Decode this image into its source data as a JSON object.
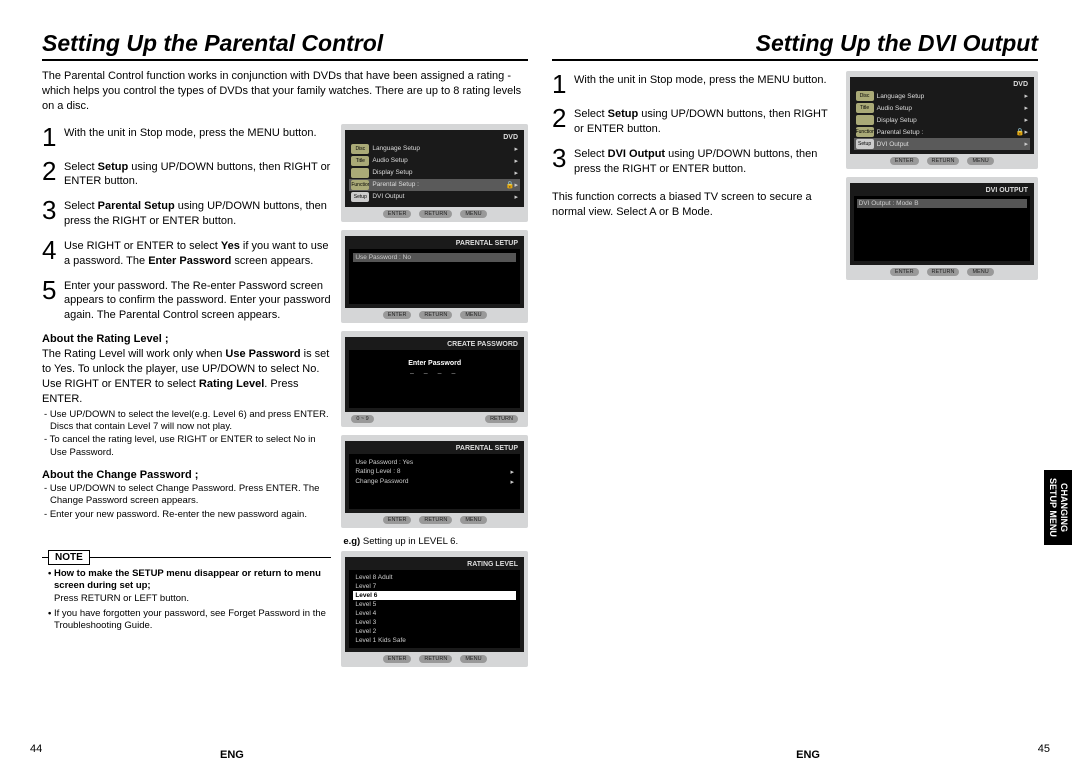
{
  "left": {
    "title": "Setting Up the Parental Control",
    "intro": "The Parental Control function works in conjunction with DVDs that have been assigned a rating - which helps you control the types of DVDs that your family watches. There are up to 8 rating levels on a disc.",
    "steps": {
      "s1": "With the unit in Stop mode, press the MENU button.",
      "s2a": "Select ",
      "s2b": "Setup",
      "s2c": " using UP/DOWN buttons, then RIGHT or ENTER button.",
      "s3a": "Select ",
      "s3b": "Parental Setup",
      "s3c": " using UP/DOWN buttons, then press the RIGHT or ENTER button.",
      "s4a": "Use RIGHT or ENTER to select ",
      "s4b": "Yes",
      "s4c": " if you want to use a password. The ",
      "s4d": "Enter Password",
      "s4e": " screen appears.",
      "s5": "Enter your password. The Re-enter Password screen appears to confirm the password. Enter your password again. The Parental Control screen appears."
    },
    "ratingHeading": "About the Rating Level ;",
    "ratingBodyA": "The Rating Level will work only when ",
    "ratingBodyB": "Use Password",
    "ratingBodyC": " is set to Yes. To unlock the player, use UP/DOWN to select No. Use RIGHT or ENTER to select ",
    "ratingBodyD": "Rating Level",
    "ratingBodyE": ". Press ENTER.",
    "ratingBullets": [
      "Use UP/DOWN to select the level(e.g. Level 6) and press ENTER. Discs that contain Level 7 will now not play.",
      "To cancel the rating level, use RIGHT or ENTER to select No in Use Password."
    ],
    "pwHeading": "About the Change Password ;",
    "pwBullets": [
      "Use UP/DOWN to select Change Password. Press ENTER. The Change Password screen appears.",
      "Enter your new password. Re-enter the new password again."
    ],
    "noteLabel": "NOTE",
    "note1b": "How to make the SETUP menu disappear or return to menu screen during set up;",
    "note1p": "Press RETURN or LEFT button.",
    "note2": "If you have forgotten your password, see Forget Password in the Troubleshooting Guide.",
    "captionA": "e.g)",
    "captionB": " Setting up in LEVEL 6.",
    "pageNum": "44",
    "eng": "ENG"
  },
  "right": {
    "title": "Setting Up the DVI Output",
    "steps": {
      "s1": "With the unit in Stop mode, press the MENU button.",
      "s2a": "Select ",
      "s2b": "Setup",
      "s2c": " using UP/DOWN buttons, then RIGHT or ENTER button.",
      "s3a": "Select ",
      "s3b": "DVI Output",
      "s3c": " using UP/DOWN buttons, then press the RIGHT or ENTER button."
    },
    "bottomText": "This function corrects a biased TV screen to secure a normal view. Select A or B Mode.",
    "pageNum": "45",
    "eng": "ENG"
  },
  "tv": {
    "headerDVD": "DVD",
    "menu": {
      "discMenu": "Disc Menu",
      "titleMenu": "Title Menu",
      "function": "Function",
      "setup": "Setup",
      "lang": "Language Setup",
      "audio": "Audio Setup",
      "display": "Display Setup",
      "parental": "Parental Setup :",
      "dvi": "DVI Output"
    },
    "btnEnter": "ENTER",
    "btnReturn": "RETURN",
    "btnMenu": "MENU",
    "parentalHeader": "PARENTAL SETUP",
    "createHeader": "CREATE PASSWORD",
    "enterPassword": "Enter Password",
    "dashes": "– – – –",
    "range": "0 ~ 9",
    "usePasswordNo": "Use Password      :  No",
    "usePasswordYes": "Use Password      :  Yes",
    "ratingLevel8": "Rating Level          :  8",
    "changePassword": "Change Password",
    "ratingHeader": "RATING LEVEL",
    "levels": [
      "Level 8 Adult",
      "Level 7",
      "Level 6",
      "Level 5",
      "Level 4",
      "Level 3",
      "Level 2",
      "Level 1 Kids Safe"
    ],
    "dviHeader": "DVI OUTPUT",
    "dviMode": "DVI Output             :  Mode B"
  },
  "sideTab1": "CHANGING",
  "sideTab2": "SETUP MENU"
}
